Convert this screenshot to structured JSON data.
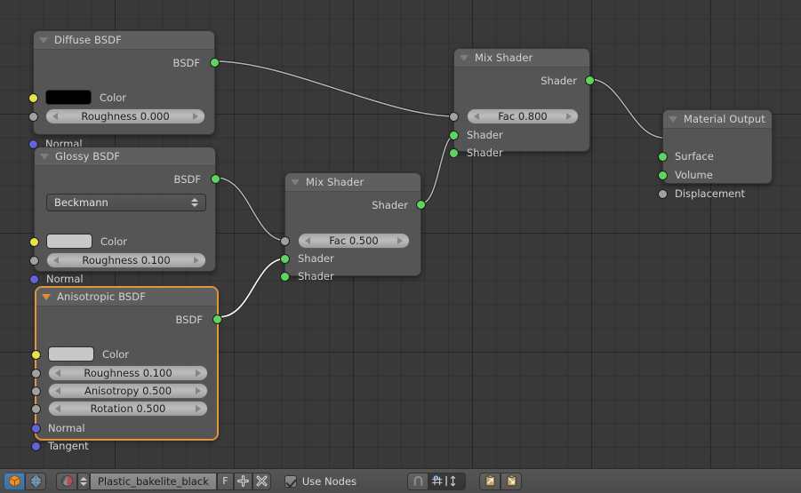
{
  "editor": {
    "name": "node-editor",
    "background_color": "#393939",
    "grid": true
  },
  "nodes": [
    {
      "id": "diffuse",
      "title": "Diffuse BSDF",
      "selected": false,
      "outputs": [
        {
          "label": "BSDF",
          "color": "green"
        }
      ],
      "inputs": [
        {
          "label": "Color",
          "color": "yellow"
        },
        {
          "label": "Roughness 0.000",
          "color": "grey"
        },
        {
          "label": "Normal",
          "color": "blue"
        }
      ],
      "widgets": {
        "color_swatch": "#000000",
        "roughness": "Roughness 0.000"
      }
    },
    {
      "id": "glossy",
      "title": "Glossy BSDF",
      "selected": false,
      "outputs": [
        {
          "label": "BSDF",
          "color": "green"
        }
      ],
      "inputs": [
        {
          "label": "Color",
          "color": "yellow"
        },
        {
          "label": "Roughness 0.100",
          "color": "grey"
        },
        {
          "label": "Normal",
          "color": "blue"
        }
      ],
      "widgets": {
        "distribution": "Beckmann",
        "color_swatch": "#c8c8c8",
        "roughness": "Roughness 0.100"
      }
    },
    {
      "id": "anisotropic",
      "title": "Anisotropic BSDF",
      "selected": true,
      "outputs": [
        {
          "label": "BSDF",
          "color": "green"
        }
      ],
      "inputs": [
        {
          "label": "Color",
          "color": "yellow"
        },
        {
          "label": "Roughness 0.100",
          "color": "grey"
        },
        {
          "label": "Anisotropy 0.500",
          "color": "grey"
        },
        {
          "label": "Rotation 0.500",
          "color": "grey"
        },
        {
          "label": "Normal",
          "color": "blue"
        },
        {
          "label": "Tangent",
          "color": "blue"
        }
      ],
      "widgets": {
        "color_swatch": "#c8c8c8",
        "roughness": "Roughness 0.100",
        "anisotropy": "Anisotropy 0.500",
        "rotation": "Rotation 0.500"
      }
    },
    {
      "id": "mix_lower",
      "title": "Mix Shader",
      "selected": false,
      "outputs": [
        {
          "label": "Shader",
          "color": "green"
        }
      ],
      "inputs": [
        {
          "label": "Fac",
          "color": "grey"
        },
        {
          "label": "Shader",
          "color": "green"
        },
        {
          "label": "Shader",
          "color": "green"
        }
      ],
      "widgets": {
        "fac": "Fac 0.500"
      }
    },
    {
      "id": "mix_upper",
      "title": "Mix Shader",
      "selected": false,
      "outputs": [
        {
          "label": "Shader",
          "color": "green"
        }
      ],
      "inputs": [
        {
          "label": "Fac",
          "color": "grey"
        },
        {
          "label": "Shader",
          "color": "green"
        },
        {
          "label": "Shader",
          "color": "green"
        }
      ],
      "widgets": {
        "fac": "Fac 0.800"
      }
    },
    {
      "id": "material_output",
      "title": "Material Output",
      "selected": false,
      "outputs": [],
      "inputs": [
        {
          "label": "Surface",
          "color": "green"
        },
        {
          "label": "Volume",
          "color": "green"
        },
        {
          "label": "Displacement",
          "color": "grey"
        }
      ],
      "widgets": {}
    }
  ],
  "node_labels": {
    "diffuse_title": "Diffuse BSDF",
    "diffuse_out_bsdf": "BSDF",
    "diffuse_color": "Color",
    "diffuse_roughness": "Roughness 0.000",
    "diffuse_normal": "Normal",
    "glossy_title": "Glossy BSDF",
    "glossy_out_bsdf": "BSDF",
    "glossy_distribution": "Beckmann",
    "glossy_color": "Color",
    "glossy_roughness": "Roughness 0.100",
    "glossy_normal": "Normal",
    "aniso_title": "Anisotropic BSDF",
    "aniso_out_bsdf": "BSDF",
    "aniso_color": "Color",
    "aniso_roughness": "Roughness 0.100",
    "aniso_anisotropy": "Anisotropy 0.500",
    "aniso_rotation": "Rotation 0.500",
    "aniso_normal": "Normal",
    "aniso_tangent": "Tangent",
    "mixlow_title": "Mix Shader",
    "mixlow_out": "Shader",
    "mixlow_fac": "Fac 0.500",
    "mixlow_in1": "Shader",
    "mixlow_in2": "Shader",
    "mixup_title": "Mix Shader",
    "mixup_out": "Shader",
    "mixup_fac": "Fac 0.800",
    "mixup_in1": "Shader",
    "mixup_in2": "Shader",
    "out_title": "Material Output",
    "out_surface": "Surface",
    "out_volume": "Volume",
    "out_displacement": "Displacement"
  },
  "links": [
    {
      "from": "diffuse.BSDF",
      "to": "mix_upper.Shader1"
    },
    {
      "from": "glossy.BSDF",
      "to": "mix_lower.Shader1"
    },
    {
      "from": "anisotropic.BSDF",
      "to": "mix_lower.Shader2",
      "highlighted": true
    },
    {
      "from": "mix_lower.Shader",
      "to": "mix_upper.Shader2"
    },
    {
      "from": "mix_upper.Shader",
      "to": "material_output.Surface"
    }
  ],
  "bottom_bar": {
    "object_icon": "object-cube-icon",
    "world_icon": "world-globe-icon",
    "material_browse_icon": "material-sphere-icon",
    "material_name": "Plastic_bakelite_black",
    "fake_user_label": "F",
    "new_material_label": "+",
    "unlink_label": "X",
    "use_nodes_label": "Use Nodes",
    "use_nodes_checked": true,
    "snap_magnet_icon": "snap-magnet-icon",
    "snap_mode_icon": "snap-mode-icon",
    "copy_icon": "copy-to-clipboard-icon",
    "paste_icon": "paste-from-clipboard-icon"
  },
  "colors": {
    "accent_orange": "#e59440",
    "socket_shader": "#5fd35f",
    "socket_color": "#e8e34c",
    "socket_value": "#a1a1a1",
    "socket_vector": "#6363d8",
    "canvas": "#393939"
  }
}
